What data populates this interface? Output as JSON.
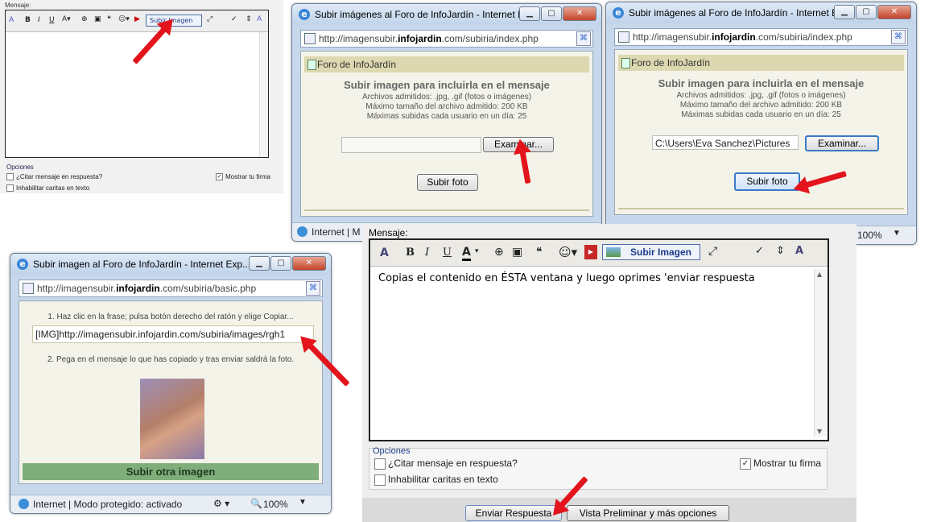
{
  "small_editor": {
    "label": "Mensaje:",
    "toolbar_icons": [
      "font-style-icon",
      "bold-icon",
      "italic-icon",
      "underline-icon",
      "font-color-icon",
      "link-icon",
      "image-icon",
      "quote-icon",
      "smiley-icon",
      "youtube-icon"
    ],
    "subir_label": "Subir Imagen",
    "options_title": "Opciones",
    "opt_citar": "¿Citar mensaje en respuesta?",
    "opt_firma": "Mostrar tu firma",
    "opt_caritas": "Inhabilitar caritas en texto"
  },
  "win1": {
    "title": "Subir imágenes al Foro de InfoJardín - Internet E...",
    "url_pre": "http://imagensubir.",
    "url_bold": "infojardin",
    "url_post": ".com/subiria/index.php",
    "panel_title": "Foro de InfoJardín",
    "heading": "Subir imagen para incluirla en el mensaje",
    "line1": "Archivos admitidos: .jpg, .gif (fotos o imágenes)",
    "line2": "Máximo tamaño del archivo admitido: 200 KB",
    "line3": "Máximas subidas cada usuario en un día: 25",
    "browse_label": "Examinar...",
    "upload_label": "Subir foto",
    "status": "Internet | M"
  },
  "win2": {
    "title": "Subir imágenes al Foro de InfoJardín - Internet E...",
    "url_pre": "http://imagensubir.",
    "url_bold": "infojardin",
    "url_post": ".com/subiria/index.php",
    "panel_title": "Foro de InfoJardín",
    "heading": "Subir imagen para incluirla en el mensaje",
    "line1": "Archivos admitidos: .jpg, .gif (fotos o imágenes)",
    "line2": "Máximo tamaño del archivo admitido: 200 KB",
    "line3": "Máximas subidas cada usuario en un día: 25",
    "file_value": "C:\\Users\\Eva Sanchez\\Pictures",
    "browse_label": "Examinar...",
    "upload_label": "Subir foto",
    "zoom": "100%"
  },
  "win3": {
    "title": "Subir imagen al Foro de InfoJardín - Internet Exp...",
    "url_pre": "http://imagensubir.",
    "url_bold": "infojardin",
    "url_post": ".com/subiria/basic.php",
    "step1": "1. Haz clic en la frase; pulsa botón derecho del ratón y elige Copiar...",
    "img_code": "[IMG]http://imagensubir.infojardin.com/subiria/images/rgh1",
    "step2": "2. Pega en el mensaje lo que has copiado y tras enviar saldrá la foto.",
    "subir_otra": "Subir otra imagen",
    "status": "Internet | Modo protegido: activado",
    "zoom": "100%"
  },
  "main_editor": {
    "label": "Mensaje:",
    "subir_label": "Subir Imagen",
    "text": "Copias el contenido en ÉSTA ventana y luego oprimes 'enviar respuesta",
    "options_title": "Opciones",
    "opt_citar": "¿Citar mensaje en respuesta?",
    "opt_firma": "Mostrar tu firma",
    "opt_caritas": "Inhabilitar caritas en texto",
    "send_label": "Enviar Respuesta",
    "preview_label": "Vista Preliminar y más opciones"
  },
  "colors": {
    "accent_green": "#7fae7a",
    "arrow_red": "#e3141c",
    "panel_bg": "#f4f3ea"
  }
}
